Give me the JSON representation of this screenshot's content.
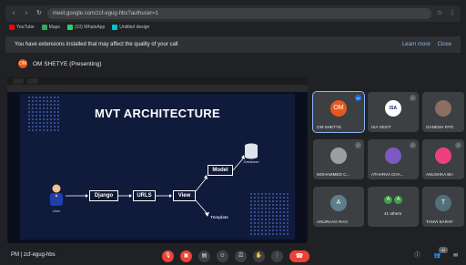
{
  "browser": {
    "url": "meet.google.com/zcf-egug-hbs?authuser=1",
    "bookmarks": [
      {
        "label": "YouTube",
        "color": "#ff0000"
      },
      {
        "label": "Maps",
        "color": "#34a853"
      },
      {
        "label": "(10) WhatsApp",
        "color": "#25d366"
      },
      {
        "label": "Untitled design",
        "color": "#00c4cc"
      }
    ]
  },
  "banner": {
    "text": "You have extensions installed that may affect the quality of your call",
    "learn_more": "Learn more",
    "close": "Close"
  },
  "presenter": {
    "initials": "OM",
    "label": "OM SHETYE (Presenting)"
  },
  "slide": {
    "title": "MVT ARCHITECTURE",
    "user": "User",
    "django": "Django",
    "urls": "URLS",
    "view": "View",
    "model": "Model",
    "template": "Template",
    "database": "Database"
  },
  "participants": [
    {
      "name": "OM SHETYE",
      "initials": "OM",
      "color": "#e8581c"
    },
    {
      "name": "ISA VESIT",
      "initials": "ISA",
      "color": "#ffffff"
    },
    {
      "name": "GANESH PATI",
      "initials": "G",
      "color": "#8d6e63"
    },
    {
      "name": "MOHAMMED C...",
      "initials": "M",
      "color": "#9e9e9e"
    },
    {
      "name": "ATHARVA CHA...",
      "initials": "A",
      "color": "#7e57c2"
    },
    {
      "name": "ANUSHKA BH",
      "initials": "A",
      "color": "#ec407a"
    },
    {
      "name": "ANURAAG RAO",
      "initials": "A",
      "color": "#607d8b"
    },
    {
      "name": "41 others",
      "initials": "A",
      "color": "#43a047"
    },
    {
      "name": "TANVI SARAF",
      "initials": "T",
      "color": "#546e7a"
    }
  ],
  "bottom": {
    "time": "PM",
    "meeting_code": "zcf-egug-hbs",
    "participant_count": "43"
  }
}
